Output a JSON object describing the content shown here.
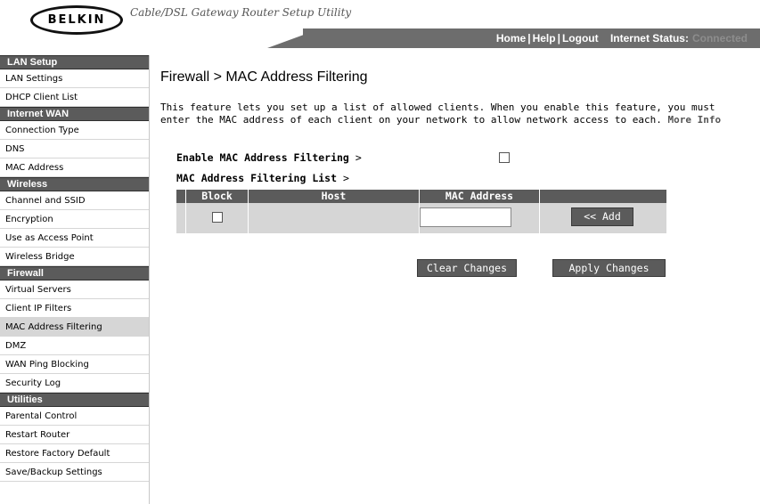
{
  "header": {
    "logo_text": "BELKIN",
    "tagline": "Cable/DSL Gateway Router Setup Utility",
    "links": [
      "Home",
      "Help",
      "Logout"
    ],
    "internet_status_label": "Internet Status:",
    "internet_status_value": "Connected"
  },
  "sidebar": {
    "sections": [
      {
        "title": "LAN Setup",
        "items": [
          "LAN Settings",
          "DHCP Client List"
        ]
      },
      {
        "title": "Internet WAN",
        "items": [
          "Connection Type",
          "DNS",
          "MAC Address"
        ]
      },
      {
        "title": "Wireless",
        "items": [
          "Channel and SSID",
          "Encryption",
          "Use as Access Point",
          "Wireless Bridge"
        ]
      },
      {
        "title": "Firewall",
        "items": [
          "Virtual Servers",
          "Client IP Filters",
          "MAC Address Filtering",
          "DMZ",
          "WAN Ping Blocking",
          "Security Log"
        ]
      },
      {
        "title": "Utilities",
        "items": [
          "Parental Control",
          "Restart Router",
          "Restore Factory Default",
          "Save/Backup Settings"
        ]
      }
    ],
    "active_item": "MAC Address Filtering"
  },
  "main": {
    "title": "Firewall > MAC Address Filtering",
    "description": "This feature lets you set up a list of allowed clients. When you enable this feature, you must enter the MAC address of each client on your network to allow network access to each.",
    "more_info": "More Info",
    "enable_label": "Enable MAC Address Filtering",
    "enable_checked": false,
    "list_label": "MAC Address Filtering List",
    "gt": ">",
    "table": {
      "headers": [
        "Block",
        "Host",
        "MAC Address"
      ],
      "mac_value": ""
    },
    "add_button": "<< Add",
    "clear_button": "Clear Changes",
    "apply_button": "Apply Changes"
  },
  "colors": {
    "bar": "#5b5b5b",
    "row": "#d6d6d6",
    "topbar": "#6d6d6d"
  }
}
